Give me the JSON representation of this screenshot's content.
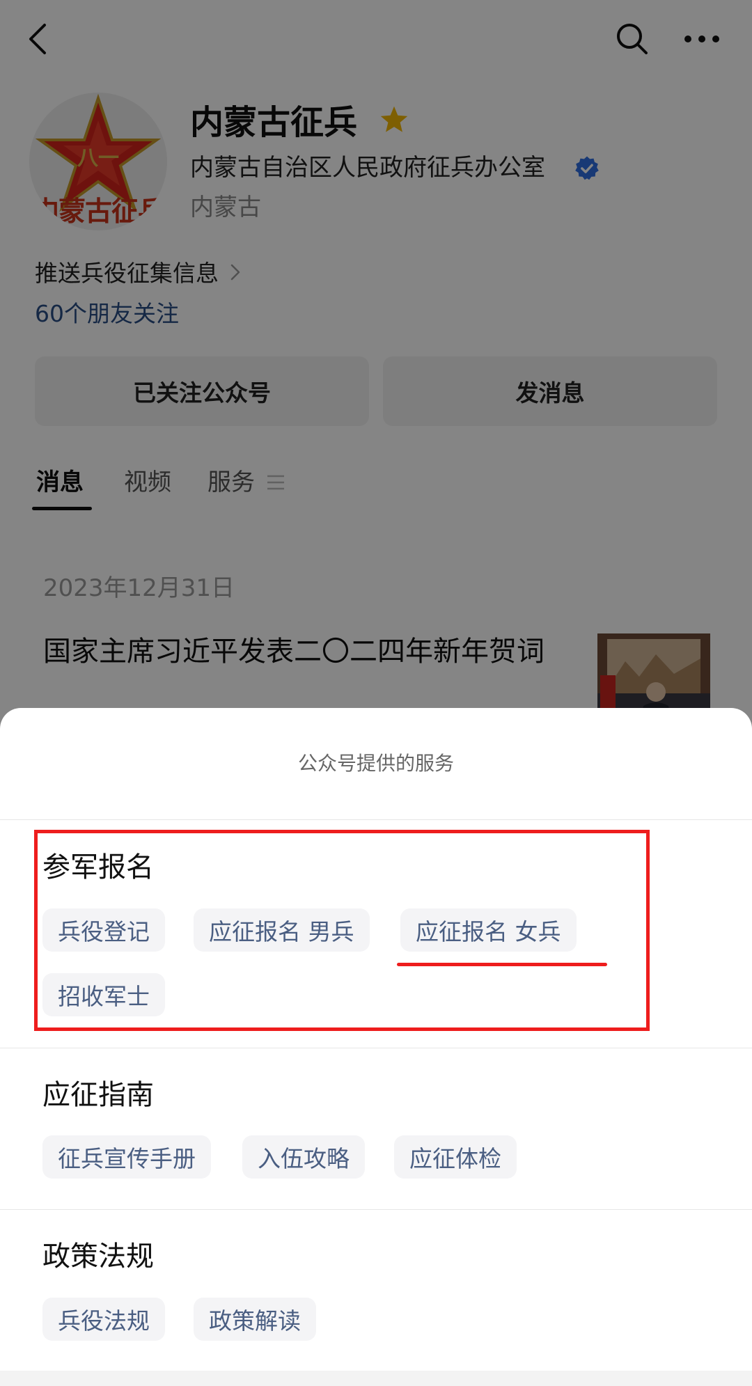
{
  "profile": {
    "name": "内蒙古征兵",
    "org": "内蒙古自治区人民政府征兵办公室",
    "region": "内蒙古",
    "avatar_text": "内蒙古征兵",
    "intro": "推送兵役征集信息",
    "friends": "60个朋友关注",
    "followed_label": "已关注公众号",
    "message_label": "发消息"
  },
  "tabs": [
    {
      "label": "消息",
      "active": true
    },
    {
      "label": "视频",
      "active": false
    },
    {
      "label": "服务",
      "active": false
    }
  ],
  "article": {
    "date": "2023年12月31日",
    "title": "国家主席习近平发表二〇二四年新年贺词"
  },
  "sheet": {
    "title": "公众号提供的服务",
    "sections": [
      {
        "title": "参军报名",
        "items": [
          "兵役登记",
          "应征报名 男兵",
          "应征报名 女兵",
          "招收军士"
        ]
      },
      {
        "title": "应征指南",
        "items": [
          "征兵宣传手册",
          "入伍攻略",
          "应征体检"
        ]
      },
      {
        "title": "政策法规",
        "items": [
          "兵役法规",
          "政策解读"
        ]
      }
    ]
  },
  "colors": {
    "annotation": "#ee1d1d",
    "link": "#2a4d85",
    "chip_text": "#4a5e82",
    "verified": "#2f6ee0",
    "star": "#f2b705"
  },
  "icons": [
    "back-arrow-icon",
    "search-icon",
    "more-icon",
    "star-icon",
    "verified-icon",
    "chevron-right-icon",
    "menu-lines-icon"
  ]
}
